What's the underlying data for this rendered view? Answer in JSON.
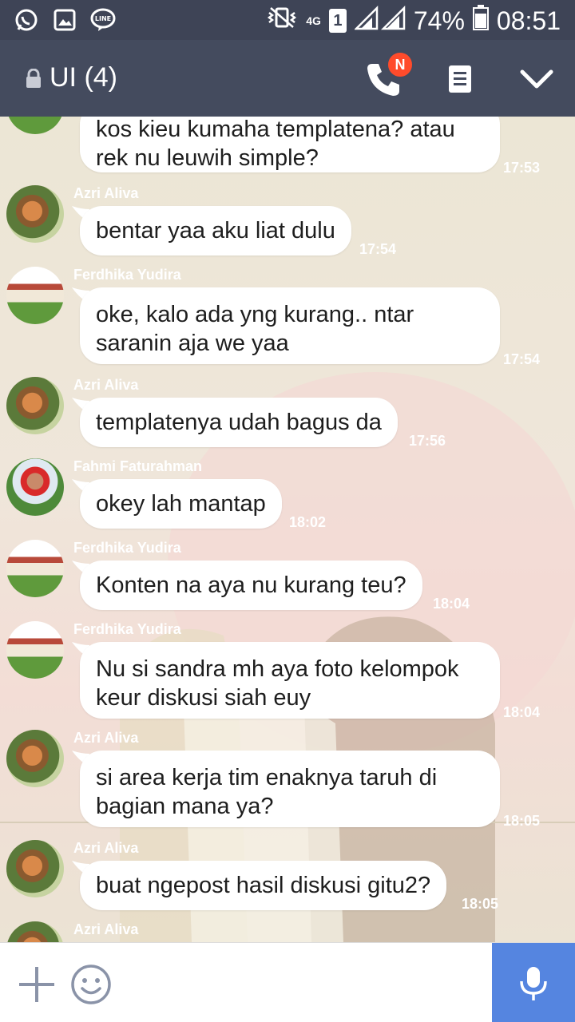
{
  "status_bar": {
    "network": "4G",
    "sim_slot": "1",
    "battery": "74%",
    "time": "08:51"
  },
  "header": {
    "title": "UI (4)",
    "call_badge": "N"
  },
  "messages": [
    {
      "sender": "",
      "text": "kos kieu kumaha templatena? atau rek nu leuwih simple?",
      "time": "17:53",
      "avatar": "school"
    },
    {
      "sender": "Azri Aliva",
      "text": "bentar yaa aku liat dulu",
      "time": "17:54",
      "avatar": "cat"
    },
    {
      "sender": "Ferdhika Yudira",
      "text": "oke, kalo ada yng kurang.. ntar saranin aja we yaa",
      "time": "17:54",
      "avatar": "school"
    },
    {
      "sender": "Azri Aliva",
      "text": "templatenya udah bagus da",
      "time": "17:56",
      "avatar": "cat"
    },
    {
      "sender": "Fahmi Faturahman",
      "text": "okey lah mantap",
      "time": "18:02",
      "avatar": "fahmi"
    },
    {
      "sender": "Ferdhika Yudira",
      "text": "Konten na aya nu kurang teu?",
      "time": "18:04",
      "avatar": "school"
    },
    {
      "sender": "Ferdhika Yudira",
      "text": "Nu si sandra mh aya foto kelompok keur diskusi siah euy",
      "time": "18:04",
      "avatar": "school"
    },
    {
      "sender": "Azri Aliva",
      "text": "si area kerja tim enaknya taruh di bagian mana ya?",
      "time": "18:05",
      "avatar": "cat"
    },
    {
      "sender": "Azri Aliva",
      "text": "buat ngepost hasil diskusi gitu2?",
      "time": "18:05",
      "avatar": "cat"
    },
    {
      "sender": "Azri Aliva",
      "text": "",
      "time": "",
      "avatar": "cat"
    }
  ],
  "icons": {
    "status_left": [
      "whatsapp-icon",
      "gallery-icon",
      "line-icon"
    ],
    "status_right": [
      "vibrate-icon",
      "sim-icon",
      "signal-icon",
      "battery-icon"
    ],
    "header": [
      "lock-icon",
      "phone-icon",
      "notes-icon",
      "chevron-down-icon"
    ],
    "input": [
      "plus-icon",
      "emoji-icon",
      "microphone-icon"
    ]
  },
  "colors": {
    "header": "#444b5e",
    "status_bar": "#3e4456",
    "badge": "#ff4b2b",
    "mic_button": "#5585e0",
    "bubble": "#ffffff"
  }
}
